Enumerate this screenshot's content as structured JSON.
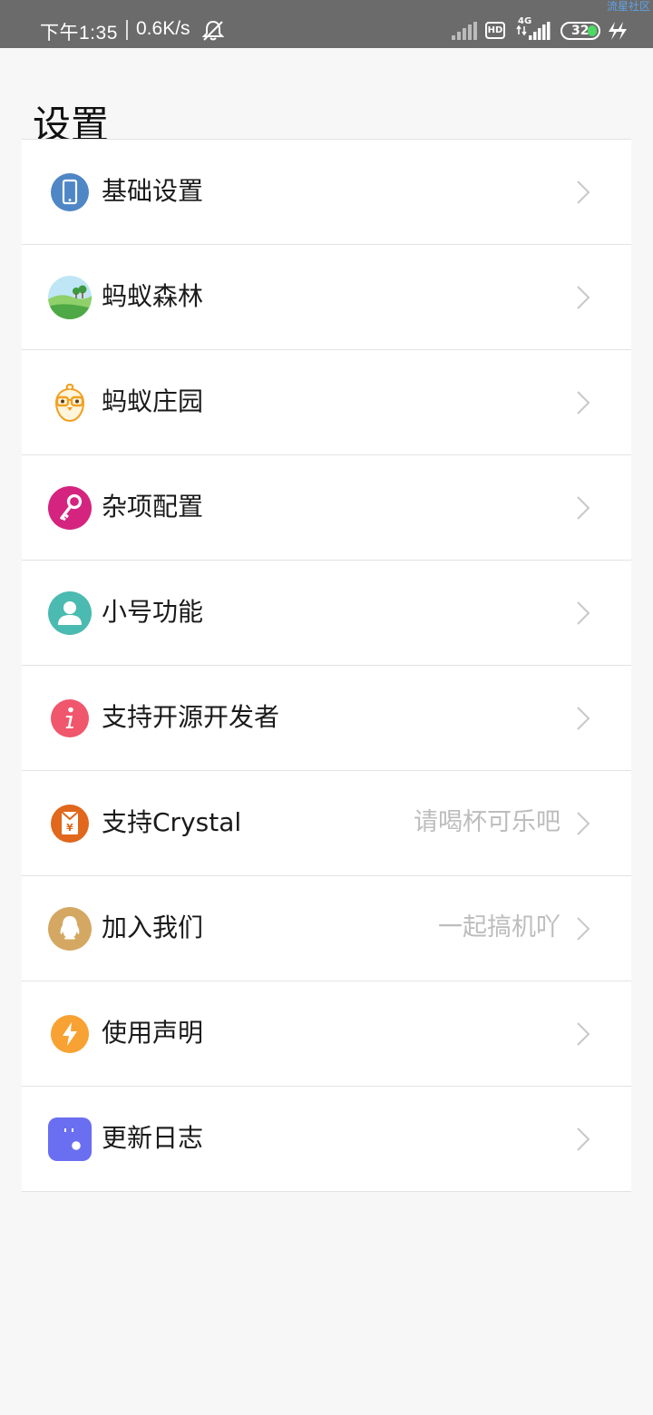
{
  "status_bar": {
    "time": "下午1:35",
    "net_speed": "0.6K/s",
    "network_type": "4G",
    "hd_badge": "HD",
    "battery": "32",
    "watermark": "流星社区"
  },
  "page": {
    "title": "设置"
  },
  "settings": [
    {
      "label": "基础设置",
      "hint": "",
      "icon": "phone-icon",
      "color": "#4f86c6"
    },
    {
      "label": "蚂蚁森林",
      "hint": "",
      "icon": "forest-icon",
      "color": "#5cb85c"
    },
    {
      "label": "蚂蚁庄园",
      "hint": "",
      "icon": "chick-icon",
      "color": "#f0a020"
    },
    {
      "label": "杂项配置",
      "hint": "",
      "icon": "key-icon",
      "color": "#d4247f"
    },
    {
      "label": "小号功能",
      "hint": "",
      "icon": "user-icon",
      "color": "#4bbab0"
    },
    {
      "label": "支持开源开发者",
      "hint": "",
      "icon": "info-icon",
      "color": "#f0566c"
    },
    {
      "label": "支持Crystal",
      "hint": "请喝杯可乐吧",
      "icon": "red-envelope-icon",
      "color": "#e0671c"
    },
    {
      "label": "加入我们",
      "hint": "一起搞机吖",
      "icon": "qq-icon",
      "color": "#d4a862"
    },
    {
      "label": "使用声明",
      "hint": "",
      "icon": "lightning-icon",
      "color": "#f7a233"
    },
    {
      "label": "更新日志",
      "hint": "",
      "icon": "log-icon",
      "color": "#6a6ef0"
    }
  ]
}
